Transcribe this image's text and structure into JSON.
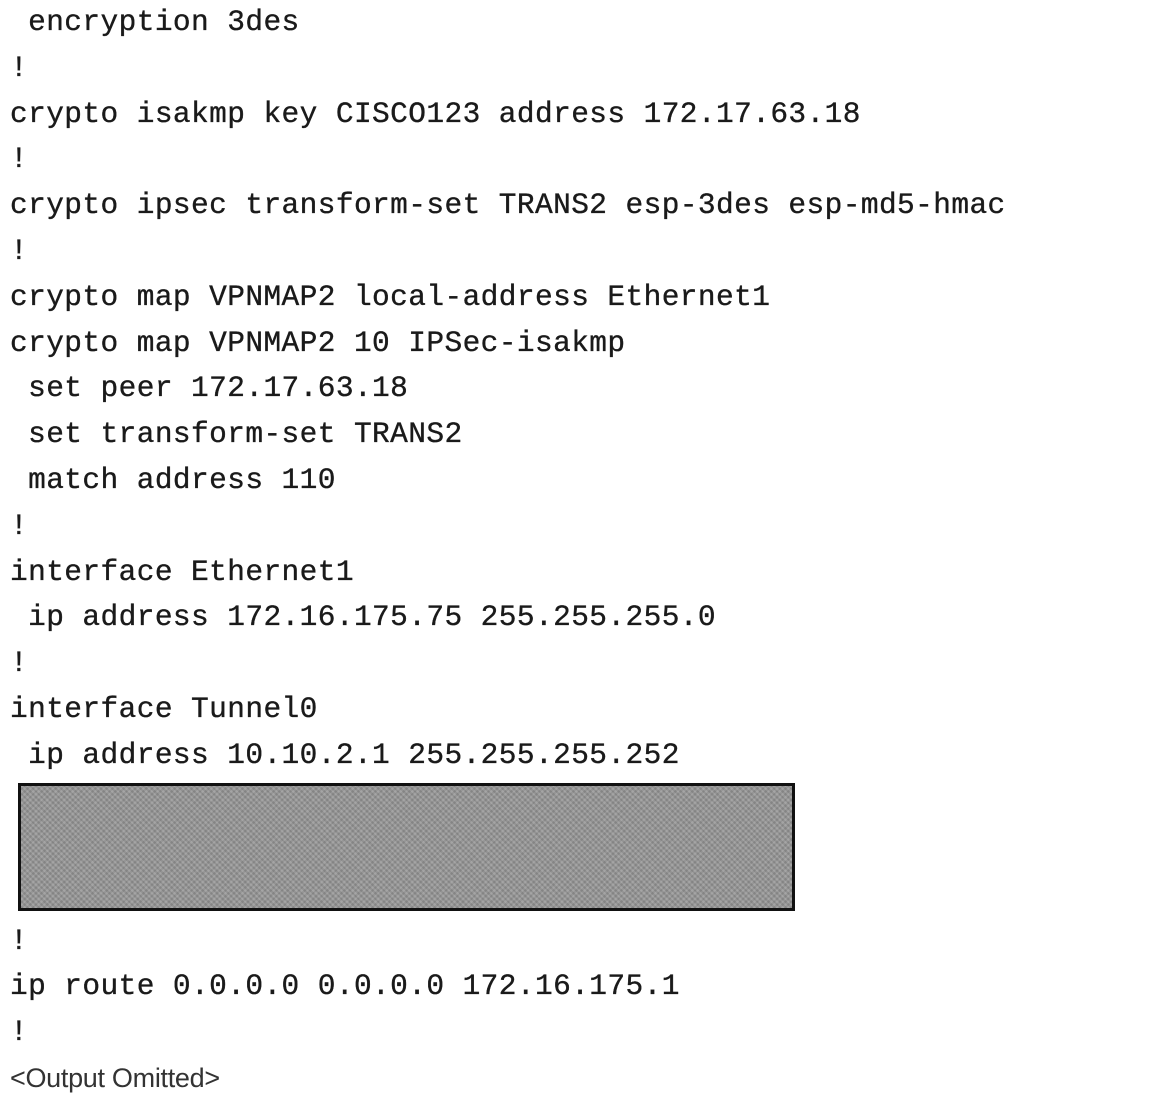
{
  "config_lines_top": [
    " encryption 3des",
    "!",
    "crypto isakmp key CISCO123 address 172.17.63.18",
    "!",
    "crypto ipsec transform-set TRANS2 esp-3des esp-md5-hmac",
    "!",
    "crypto map VPNMAP2 local-address Ethernet1",
    "crypto map VPNMAP2 10 IPSec-isakmp",
    " set peer 172.17.63.18",
    " set transform-set TRANS2",
    " match address 110",
    "!",
    "interface Ethernet1",
    " ip address 172.16.175.75 255.255.255.0",
    "!",
    "interface Tunnel0",
    " ip address 10.10.2.1 255.255.255.252"
  ],
  "config_lines_bottom": [
    "!",
    "ip route 0.0.0.0 0.0.0.0 172.16.175.1",
    "!"
  ],
  "footer_note": "<Output Omitted>"
}
